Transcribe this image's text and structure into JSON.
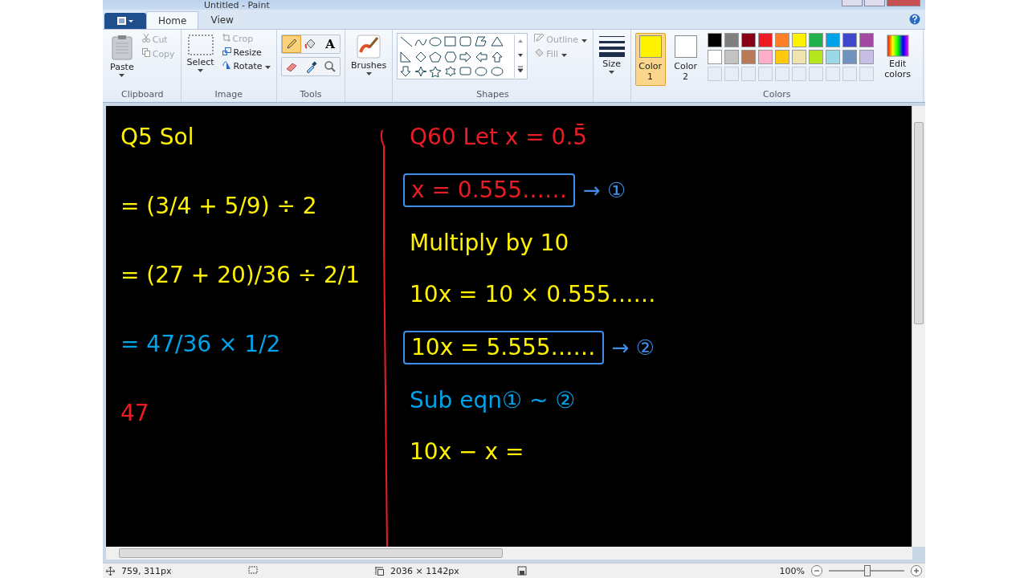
{
  "window": {
    "title": "Untitled - Paint"
  },
  "tabs": [
    {
      "label": "Home",
      "selected": true
    },
    {
      "label": "View",
      "selected": false
    }
  ],
  "ribbon": {
    "clipboard": {
      "paste": "Paste",
      "cut": "Cut",
      "copy": "Copy",
      "label": "Clipboard"
    },
    "image": {
      "select": "Select",
      "crop": "Crop",
      "resize": "Resize",
      "rotate": "Rotate",
      "label": "Image"
    },
    "tools": {
      "label": "Tools",
      "text_tool": "A"
    },
    "brushes": {
      "label": "Brushes"
    },
    "shapes": {
      "outline": "Outline",
      "fill": "Fill",
      "label": "Shapes"
    },
    "size": {
      "label": "Size"
    },
    "colors": {
      "color1": {
        "label": "Color",
        "number": "1",
        "selected": true,
        "color": "#fff200"
      },
      "color2": {
        "label": "Color",
        "number": "2",
        "selected": false,
        "color": "#ffffff"
      },
      "palette": [
        {
          "color": "#000000"
        },
        {
          "color": "#7f7f7f"
        },
        {
          "color": "#880015"
        },
        {
          "color": "#ed1c24"
        },
        {
          "color": "#ff7f27"
        },
        {
          "color": "#fff200"
        },
        {
          "color": "#22b14c"
        },
        {
          "color": "#00a2e8"
        },
        {
          "color": "#3f48cc"
        },
        {
          "color": "#a349a4"
        },
        {
          "color": "#ffffff"
        },
        {
          "color": "#c3c3c3"
        },
        {
          "color": "#b97a57"
        },
        {
          "color": "#ffaec9"
        },
        {
          "color": "#ffc90e"
        },
        {
          "color": "#efe4b0"
        },
        {
          "color": "#b5e61d"
        },
        {
          "color": "#99d9ea"
        },
        {
          "color": "#7092be"
        },
        {
          "color": "#c8bfe7"
        }
      ],
      "edit": "Edit colors",
      "label": "Colors"
    }
  },
  "canvas": {
    "left_notes": [
      {
        "text": "Q5 Sol",
        "color": "#fff200",
        "boxed": false
      },
      {
        "text": "= (3/4 + 5/9) ÷ 2",
        "color": "#fff200",
        "boxed": false
      },
      {
        "text": "= (27 + 20)/36 ÷ 2/1",
        "color": "#fff200",
        "boxed": false
      },
      {
        "text": "= 47/36 × 1/2",
        "color": "#00a2e8",
        "boxed": false
      },
      {
        "text": "47",
        "color": "#ed1c24",
        "boxed": false
      }
    ],
    "right_notes": [
      {
        "text": "Q60  Let x = 0.5̄",
        "color": "#ed1c24",
        "boxed": false
      },
      {
        "text": "x = 0.555……",
        "color": "#ed1c24",
        "boxed": true,
        "tag": "→ ①"
      },
      {
        "text": "Multiply by 10",
        "color": "#fff200",
        "boxed": false
      },
      {
        "text": "10x = 10 × 0.555……",
        "color": "#fff200",
        "boxed": false
      },
      {
        "text": "10x = 5.555……",
        "color": "#fff200",
        "boxed": true,
        "tag": "→ ②"
      },
      {
        "text": "Sub eqn① ~ ②",
        "color": "#00a2e8",
        "boxed": false
      },
      {
        "text": "10x − x =",
        "color": "#fff200",
        "boxed": false
      }
    ]
  },
  "status_bar": {
    "position": "759, 311px",
    "size": "2036 × 1142px",
    "zoom": "100%",
    "zoom_slider": {
      "level": 0.5
    }
  }
}
